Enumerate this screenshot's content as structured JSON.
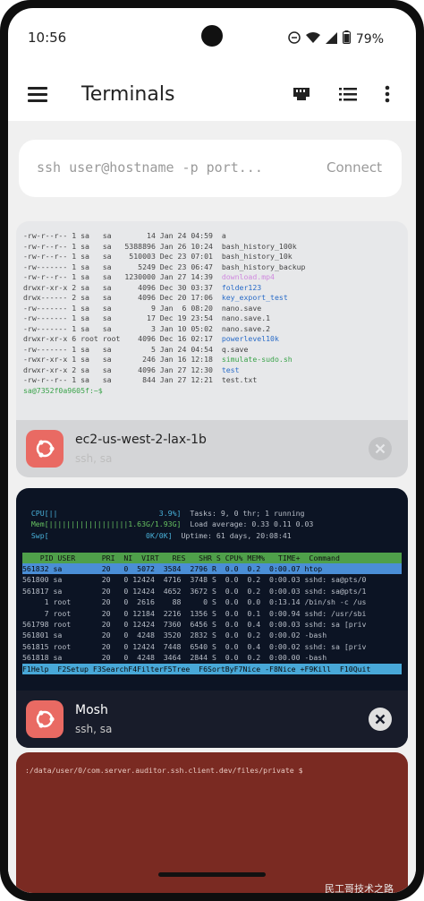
{
  "status": {
    "time": "10:56",
    "battery": "79%"
  },
  "app_bar": {
    "title": "Terminals"
  },
  "connect": {
    "placeholder": "ssh user@hostname -p port...",
    "button": "Connect"
  },
  "sessions": [
    {
      "name": "ec2-us-west-2-lax-1b",
      "subtitle": "ssh, sa",
      "terminal_lines": [
        {
          "meta": "-rw-r--r-- 1 sa   sa        14 Jan 24 04:59  ",
          "name": "a",
          "color": ""
        },
        {
          "meta": "-rw-r--r-- 1 sa   sa   5388896 Jan 26 10:24  ",
          "name": "bash_history_100k",
          "color": ""
        },
        {
          "meta": "-rw-r--r-- 1 sa   sa    510003 Dec 23 07:01  ",
          "name": "bash_history_10k",
          "color": ""
        },
        {
          "meta": "-rw------- 1 sa   sa      5249 Dec 23 06:47  ",
          "name": "bash_history_backup",
          "color": ""
        },
        {
          "meta": "-rw-r--r-- 1 sa   sa   1230000 Jan 27 14:39  ",
          "name": "download.mp4",
          "color": "magenta"
        },
        {
          "meta": "drwxr-xr-x 2 sa   sa      4096 Dec 30 03:37  ",
          "name": "folder123",
          "color": "blue"
        },
        {
          "meta": "drwx------ 2 sa   sa      4096 Dec 20 17:06  ",
          "name": "key_export_test",
          "color": "blue"
        },
        {
          "meta": "-rw------- 1 sa   sa         9 Jan  6 08:20  ",
          "name": "nano.save",
          "color": ""
        },
        {
          "meta": "-rw------- 1 sa   sa        17 Dec 19 23:54  ",
          "name": "nano.save.1",
          "color": ""
        },
        {
          "meta": "-rw------- 1 sa   sa         3 Jan 10 05:02  ",
          "name": "nano.save.2",
          "color": ""
        },
        {
          "meta": "drwxr-xr-x 6 root root    4096 Dec 16 02:17  ",
          "name": "powerlevel10k",
          "color": "blue"
        },
        {
          "meta": "-rw------- 1 sa   sa         5 Jan 24 04:54  ",
          "name": "q.save",
          "color": ""
        },
        {
          "meta": "-rwxr-xr-x 1 sa   sa       246 Jan 16 12:18  ",
          "name": "simulate-sudo.sh",
          "color": "green"
        },
        {
          "meta": "drwxr-xr-x 2 sa   sa      4096 Jan 27 12:30  ",
          "name": "test",
          "color": "blue"
        },
        {
          "meta": "-rw-r--r-- 1 sa   sa       844 Jan 27 12:21  ",
          "name": "test.txt",
          "color": ""
        }
      ],
      "prompt": "sa@7352f0a9605f:~$"
    },
    {
      "name": "Mosh",
      "subtitle": "ssh, sa",
      "htop": {
        "cpu": "  CPU[||                       3.9%]",
        "mem_label": "  Mem[||||||||||||||||||1.63G/1.93G]",
        "swp": "  Swp[                      0K/0K]",
        "tasks": "  Tasks: 9, 0 thr; 1 running",
        "load": "  Load average: 0.33 0.11 0.03",
        "uptime": "  Uptime: 61 days, 20:08:41",
        "header": "    PID USER      PRI  NI  VIRT   RES   SHR S CPU% MEM%   TIME+  Command",
        "rows": [
          "561832 sa         20   0  5072  3584  2796 R  0.0  0.2  0:00.07 htop",
          "561800 sa         20   0 12424  4716  3748 S  0.0  0.2  0:00.03 sshd: sa@pts/0",
          "561817 sa         20   0 12424  4652  3672 S  0.0  0.2  0:00.03 sshd: sa@pts/1",
          "     1 root       20   0  2616    88     0 S  0.0  0.0  0:13.14 /bin/sh -c /us",
          "     7 root       20   0 12184  2216  1356 S  0.0  0.1  0:00.94 sshd: /usr/sbi",
          "561798 root       20   0 12424  7360  6456 S  0.0  0.4  0:00.03 sshd: sa [priv",
          "561801 sa         20   0  4248  3520  2832 S  0.0  0.2  0:00.02 -bash",
          "561815 root       20   0 12424  7448  6540 S  0.0  0.4  0:00.02 sshd: sa [priv",
          "561818 sa         20   0  4248  3464  2844 S  0.0  0.2  0:00.00 -bash"
        ],
        "fkeys": "F1Help  F2Setup F3SearchF4FilterF5Tree  F6SortByF7Nice -F8Nice +F9Kill  F10Quit"
      }
    },
    {
      "terminal_line": ":/data/user/0/com.server.auditor.ssh.client.dev/files/private $"
    }
  ],
  "watermark": "民工哥技术之路",
  "colors": {
    "badge": "#e96a63",
    "card3_bg": "#7a2a22",
    "card2_bg": "#0c1424"
  }
}
